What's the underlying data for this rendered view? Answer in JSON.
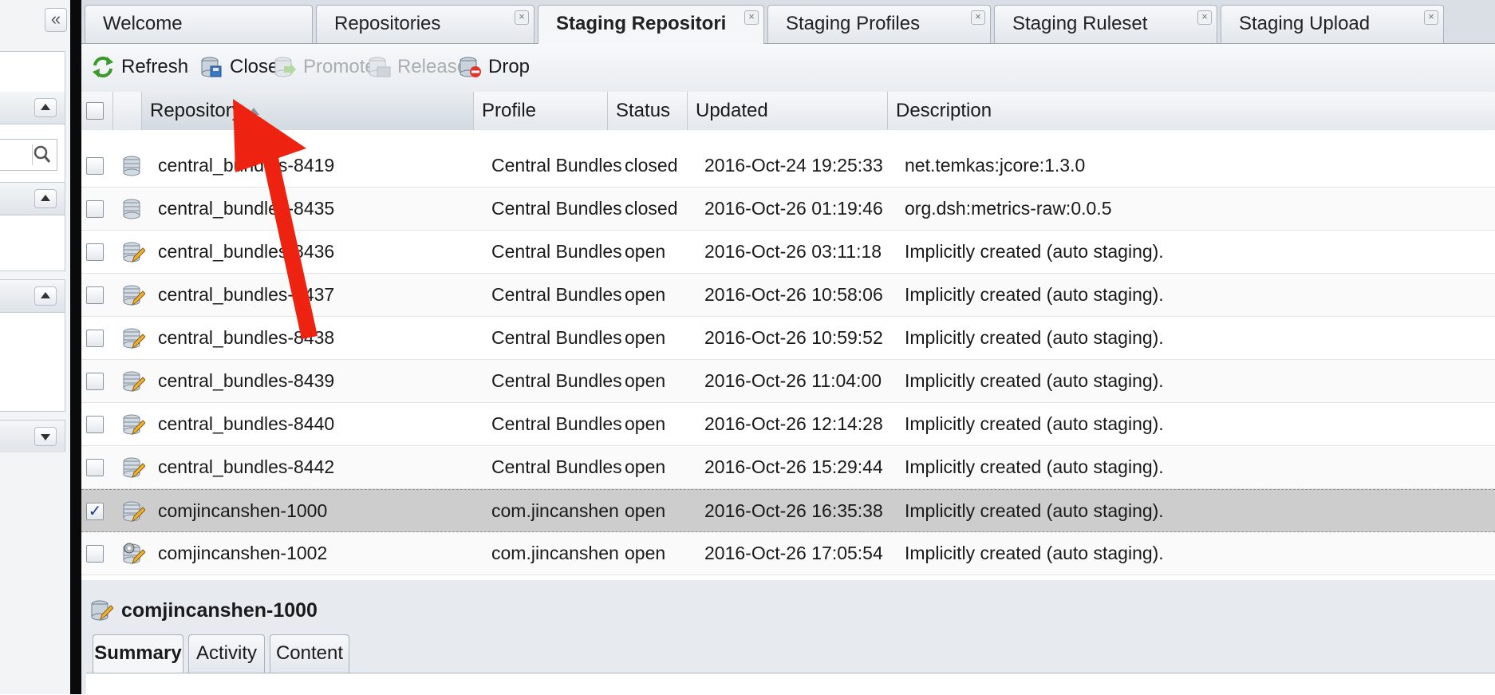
{
  "tabs": [
    {
      "label": "Welcome",
      "closable": false,
      "active": false
    },
    {
      "label": "Repositories",
      "closable": true,
      "active": false
    },
    {
      "label": "Staging Repositori",
      "closable": true,
      "active": true
    },
    {
      "label": "Staging Profiles",
      "closable": true,
      "active": false
    },
    {
      "label": "Staging Ruleset",
      "closable": true,
      "active": false
    },
    {
      "label": "Staging Upload",
      "closable": true,
      "active": false
    }
  ],
  "toolbar": {
    "refresh_label": "Refresh",
    "close_label": "Close",
    "promote_label": "Promote",
    "release_label": "Release",
    "drop_label": "Drop",
    "disabled": [
      "Promote",
      "Release"
    ]
  },
  "grid": {
    "columns": [
      "Repository",
      "Profile",
      "Status",
      "Updated",
      "Description"
    ],
    "sorted_column": "Repository",
    "sort_direction": "ascending",
    "rows": [
      {
        "repository": "central_bundles-8419",
        "profile": "Central Bundles",
        "status": "closed",
        "updated": "2016-Oct-24 19:25:33",
        "description": "net.temkas:jcore:1.3.0",
        "icon": "database-icon",
        "checked": false
      },
      {
        "repository": "central_bundles-8435",
        "profile": "Central Bundles",
        "status": "closed",
        "updated": "2016-Oct-26 01:19:46",
        "description": "org.dsh:metrics-raw:0.0.5",
        "icon": "database-icon",
        "checked": false
      },
      {
        "repository": "central_bundles-8436",
        "profile": "Central Bundles",
        "status": "open",
        "updated": "2016-Oct-26 03:11:18",
        "description": "Implicitly created (auto staging).",
        "icon": "database-edit-icon",
        "checked": false
      },
      {
        "repository": "central_bundles-8437",
        "profile": "Central Bundles",
        "status": "open",
        "updated": "2016-Oct-26 10:58:06",
        "description": "Implicitly created (auto staging).",
        "icon": "database-edit-icon",
        "checked": false
      },
      {
        "repository": "central_bundles-8438",
        "profile": "Central Bundles",
        "status": "open",
        "updated": "2016-Oct-26 10:59:52",
        "description": "Implicitly created (auto staging).",
        "icon": "database-edit-icon",
        "checked": false
      },
      {
        "repository": "central_bundles-8439",
        "profile": "Central Bundles",
        "status": "open",
        "updated": "2016-Oct-26 11:04:00",
        "description": "Implicitly created (auto staging).",
        "icon": "database-edit-icon",
        "checked": false
      },
      {
        "repository": "central_bundles-8440",
        "profile": "Central Bundles",
        "status": "open",
        "updated": "2016-Oct-26 12:14:28",
        "description": "Implicitly created (auto staging).",
        "icon": "database-edit-icon",
        "checked": false
      },
      {
        "repository": "central_bundles-8442",
        "profile": "Central Bundles",
        "status": "open",
        "updated": "2016-Oct-26 15:29:44",
        "description": "Implicitly created (auto staging).",
        "icon": "database-edit-icon",
        "checked": false
      },
      {
        "repository": "comjincanshen-1000",
        "profile": "com.jincanshen",
        "status": "open",
        "updated": "2016-Oct-26 16:35:38",
        "description": "Implicitly created (auto staging).",
        "icon": "database-edit-icon",
        "checked": true
      },
      {
        "repository": "comjincanshen-1002",
        "profile": "com.jincanshen",
        "status": "open",
        "updated": "2016-Oct-26 17:05:54",
        "description": "Implicitly created (auto staging).",
        "icon": "database-gear-icon",
        "checked": false
      }
    ]
  },
  "detail": {
    "title": "comjincanshen-1000",
    "tabs": [
      {
        "label": "Summary",
        "active": true
      },
      {
        "label": "Activity",
        "active": false
      },
      {
        "label": "Content",
        "active": false
      }
    ]
  },
  "annotation": {
    "type": "red-arrow",
    "color": "#ee2211",
    "points_to": "Close"
  },
  "colors": {
    "accent_arrow": "#ee2211",
    "selected_row": "#cdcdcd",
    "disabled_text": "#a9aeb3"
  }
}
